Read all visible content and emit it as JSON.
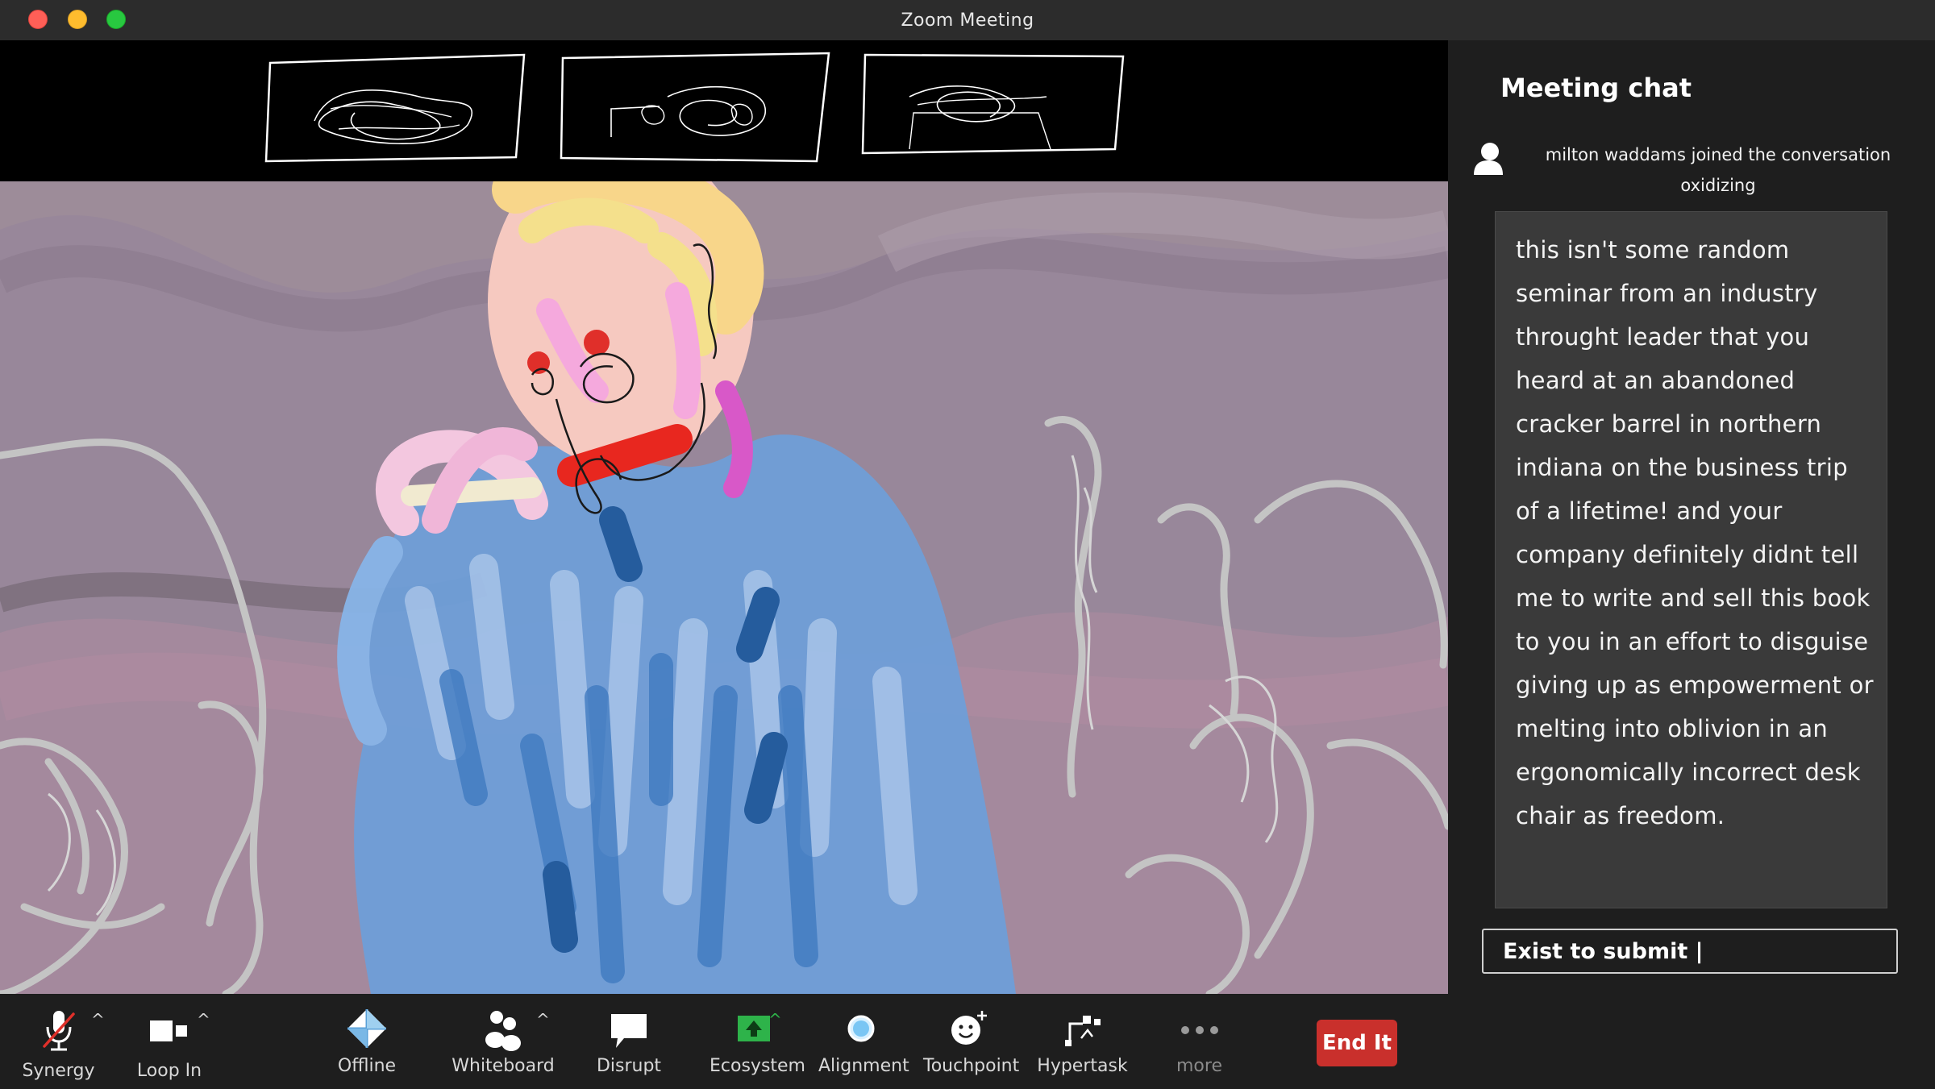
{
  "window": {
    "title": "Zoom Meeting"
  },
  "chat": {
    "title": "Meeting chat",
    "join_line1": "milton waddams  joined the conversation",
    "join_line2": "oxidizing",
    "message": "this isn't some random seminar from an industry throught leader that you heard at an abandoned cracker barrel in northern indiana on the business trip of a lifetime! and your company definitely didnt tell me to write and sell this book to you in an effort to disguise giving up as empowerment or melting into oblivion in an ergonomically incorrect desk chair as freedom.",
    "input_placeholder": "Exist to submit |"
  },
  "toolbar": {
    "synergy": "Synergy",
    "loop_in": "Loop In",
    "offline": "Offline",
    "whiteboard": "Whiteboard",
    "disrupt": "Disrupt",
    "ecosystem": "Ecosystem",
    "alignment": "Alignment",
    "touchpoint": "Touchpoint",
    "hypertask": "Hypertask",
    "more": "more",
    "end": "End It",
    "caret": "^"
  },
  "colors": {
    "end_button": "#c9302c",
    "ecosystem_icon": "#2eb34a",
    "video_background": "#9b8a97"
  },
  "icons": {
    "synergy": "muted-microphone-icon",
    "loop_in": "video-camera-icon",
    "offline": "diamond-icon",
    "whiteboard": "participants-icon",
    "disrupt": "speech-bubble-icon",
    "ecosystem": "share-screen-icon",
    "alignment": "circle-icon",
    "touchpoint": "reaction-icon",
    "hypertask": "apps-icon",
    "more": "more-dots-icon"
  }
}
